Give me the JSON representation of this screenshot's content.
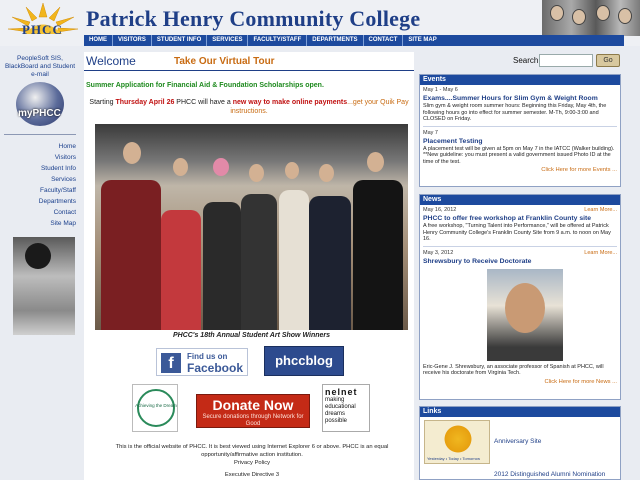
{
  "header": {
    "college_name": "Patrick Henry Community College",
    "logo_text": "PHCC"
  },
  "nav": {
    "items": [
      "HOME",
      "VISITORS",
      "STUDENT INFO",
      "SERVICES",
      "FACULTY/STAFF",
      "DEPARTMENTS",
      "CONTACT",
      "SITE MAP"
    ]
  },
  "sidebar": {
    "portal_text": "PeopleSoft SIS, BlackBoard and Student e-mail",
    "myphcc_label": "myPHCC",
    "links": [
      "Home",
      "Visitors",
      "Student Info",
      "Services",
      "Faculty/Staff",
      "Departments",
      "Contact",
      "Site Map"
    ]
  },
  "main": {
    "welcome": "Welcome",
    "tour": "Take Our Virtual Tour",
    "aid_notice": "Summer Application for Financial Aid & Foundation Scholarships open.",
    "payments": {
      "prefix": "Starting ",
      "date": "Thursday April 26",
      "mid": " PHCC will have a ",
      "highlight": "new way to make online payments",
      "suffix": "...get your Quik Pay instructions."
    },
    "caption": "PHCC's 18th Annual Student Art Show Winners",
    "facebook": {
      "line1": "Find us on",
      "line2": "Facebook"
    },
    "blog": "phccblog",
    "donate": {
      "title": "Donate Now",
      "sub": "Secure donations through Network for Good"
    },
    "dream_text": "Achieving the Dream",
    "nelnet": {
      "brand": "nelnet",
      "tagline": "making educational dreams possible"
    },
    "footer": {
      "line1": "This is the official website of PHCC. It is best viewed using Internet Explorer 6 or above. PHCC is an equal opportunity/affirmative action institution.",
      "privacy": "Privacy Policy",
      "exec": "Executive Directive 3"
    }
  },
  "search": {
    "label": "Search",
    "value": "",
    "button": "Go"
  },
  "events": {
    "title": "Events",
    "items": [
      {
        "date": "May 1 - May 6",
        "headline": "Exams....Summer Hours for Slim Gym & Weight Room",
        "text": "Slim gym & weight room summer hours: Beginning this Friday, May 4th, the following hours go into effect for summer semester. M-Th, 9:00-3:00 and CLOSED on Friday."
      },
      {
        "date": "May 7",
        "headline": "Placement Testing",
        "text": "A placement test will be given at 5pm on May 7 in the IATCC (Walker building). **New guideline: you must present a valid government issued Photo ID at the time of the test."
      }
    ],
    "more": "Click Here for more Events ..."
  },
  "news": {
    "title": "News",
    "learn_more": "Learn More...",
    "items": [
      {
        "date": "May 16, 2012",
        "headline": "PHCC to offer free workshop at Franklin County site",
        "text": "A free workshop, \"Turning Talent into Performance,\" will be offered at Patrick Henry Community College's Franklin County Site from 9 a.m. to noon on May 16."
      },
      {
        "date": "May 3, 2012",
        "headline": "Shrewsbury to Receive Doctorate",
        "text": "Eric-Gene J. Shrewsbury, an associate professor of Spanish at PHCC, will receive his doctorate from Virginia Tech."
      }
    ],
    "more": "Click Here for more News ..."
  },
  "links": {
    "title": "Links",
    "anniversary": "Anniversary Site",
    "anniversary_tagline": "Yesterday • Today • Tomorrow",
    "alumni": "2012 Distinguished Alumni Nomination"
  },
  "colors": {
    "nav_blue": "#1d4a9e",
    "title_blue": "#1f3f87",
    "accent_orange": "#c86b12",
    "alert_red": "#c01010",
    "aid_green": "#1e8a1e"
  }
}
